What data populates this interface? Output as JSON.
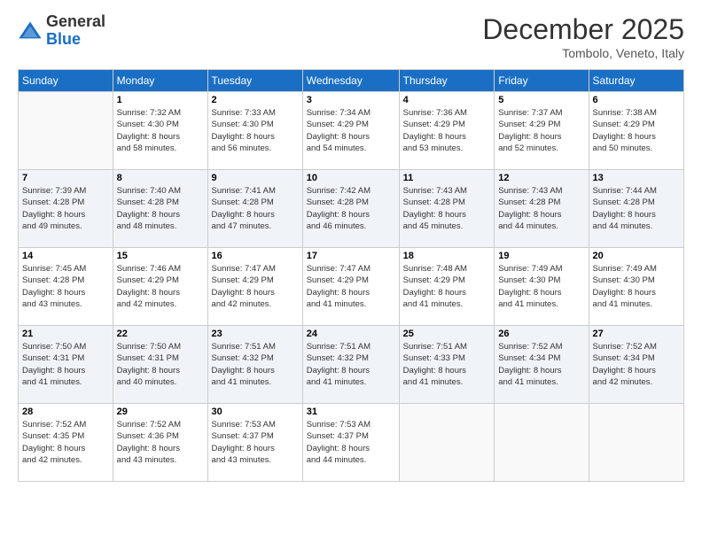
{
  "logo": {
    "general": "General",
    "blue": "Blue"
  },
  "title": "December 2025",
  "location": "Tombolo, Veneto, Italy",
  "weekdays": [
    "Sunday",
    "Monday",
    "Tuesday",
    "Wednesday",
    "Thursday",
    "Friday",
    "Saturday"
  ],
  "weeks": [
    [
      {
        "day": "",
        "info": ""
      },
      {
        "day": "1",
        "info": "Sunrise: 7:32 AM\nSunset: 4:30 PM\nDaylight: 8 hours\nand 58 minutes."
      },
      {
        "day": "2",
        "info": "Sunrise: 7:33 AM\nSunset: 4:30 PM\nDaylight: 8 hours\nand 56 minutes."
      },
      {
        "day": "3",
        "info": "Sunrise: 7:34 AM\nSunset: 4:29 PM\nDaylight: 8 hours\nand 54 minutes."
      },
      {
        "day": "4",
        "info": "Sunrise: 7:36 AM\nSunset: 4:29 PM\nDaylight: 8 hours\nand 53 minutes."
      },
      {
        "day": "5",
        "info": "Sunrise: 7:37 AM\nSunset: 4:29 PM\nDaylight: 8 hours\nand 52 minutes."
      },
      {
        "day": "6",
        "info": "Sunrise: 7:38 AM\nSunset: 4:29 PM\nDaylight: 8 hours\nand 50 minutes."
      }
    ],
    [
      {
        "day": "7",
        "info": "Sunrise: 7:39 AM\nSunset: 4:28 PM\nDaylight: 8 hours\nand 49 minutes."
      },
      {
        "day": "8",
        "info": "Sunrise: 7:40 AM\nSunset: 4:28 PM\nDaylight: 8 hours\nand 48 minutes."
      },
      {
        "day": "9",
        "info": "Sunrise: 7:41 AM\nSunset: 4:28 PM\nDaylight: 8 hours\nand 47 minutes."
      },
      {
        "day": "10",
        "info": "Sunrise: 7:42 AM\nSunset: 4:28 PM\nDaylight: 8 hours\nand 46 minutes."
      },
      {
        "day": "11",
        "info": "Sunrise: 7:43 AM\nSunset: 4:28 PM\nDaylight: 8 hours\nand 45 minutes."
      },
      {
        "day": "12",
        "info": "Sunrise: 7:43 AM\nSunset: 4:28 PM\nDaylight: 8 hours\nand 44 minutes."
      },
      {
        "day": "13",
        "info": "Sunrise: 7:44 AM\nSunset: 4:28 PM\nDaylight: 8 hours\nand 44 minutes."
      }
    ],
    [
      {
        "day": "14",
        "info": "Sunrise: 7:45 AM\nSunset: 4:28 PM\nDaylight: 8 hours\nand 43 minutes."
      },
      {
        "day": "15",
        "info": "Sunrise: 7:46 AM\nSunset: 4:29 PM\nDaylight: 8 hours\nand 42 minutes."
      },
      {
        "day": "16",
        "info": "Sunrise: 7:47 AM\nSunset: 4:29 PM\nDaylight: 8 hours\nand 42 minutes."
      },
      {
        "day": "17",
        "info": "Sunrise: 7:47 AM\nSunset: 4:29 PM\nDaylight: 8 hours\nand 41 minutes."
      },
      {
        "day": "18",
        "info": "Sunrise: 7:48 AM\nSunset: 4:29 PM\nDaylight: 8 hours\nand 41 minutes."
      },
      {
        "day": "19",
        "info": "Sunrise: 7:49 AM\nSunset: 4:30 PM\nDaylight: 8 hours\nand 41 minutes."
      },
      {
        "day": "20",
        "info": "Sunrise: 7:49 AM\nSunset: 4:30 PM\nDaylight: 8 hours\nand 41 minutes."
      }
    ],
    [
      {
        "day": "21",
        "info": "Sunrise: 7:50 AM\nSunset: 4:31 PM\nDaylight: 8 hours\nand 41 minutes."
      },
      {
        "day": "22",
        "info": "Sunrise: 7:50 AM\nSunset: 4:31 PM\nDaylight: 8 hours\nand 40 minutes."
      },
      {
        "day": "23",
        "info": "Sunrise: 7:51 AM\nSunset: 4:32 PM\nDaylight: 8 hours\nand 41 minutes."
      },
      {
        "day": "24",
        "info": "Sunrise: 7:51 AM\nSunset: 4:32 PM\nDaylight: 8 hours\nand 41 minutes."
      },
      {
        "day": "25",
        "info": "Sunrise: 7:51 AM\nSunset: 4:33 PM\nDaylight: 8 hours\nand 41 minutes."
      },
      {
        "day": "26",
        "info": "Sunrise: 7:52 AM\nSunset: 4:34 PM\nDaylight: 8 hours\nand 41 minutes."
      },
      {
        "day": "27",
        "info": "Sunrise: 7:52 AM\nSunset: 4:34 PM\nDaylight: 8 hours\nand 42 minutes."
      }
    ],
    [
      {
        "day": "28",
        "info": "Sunrise: 7:52 AM\nSunset: 4:35 PM\nDaylight: 8 hours\nand 42 minutes."
      },
      {
        "day": "29",
        "info": "Sunrise: 7:52 AM\nSunset: 4:36 PM\nDaylight: 8 hours\nand 43 minutes."
      },
      {
        "day": "30",
        "info": "Sunrise: 7:53 AM\nSunset: 4:37 PM\nDaylight: 8 hours\nand 43 minutes."
      },
      {
        "day": "31",
        "info": "Sunrise: 7:53 AM\nSunset: 4:37 PM\nDaylight: 8 hours\nand 44 minutes."
      },
      {
        "day": "",
        "info": ""
      },
      {
        "day": "",
        "info": ""
      },
      {
        "day": "",
        "info": ""
      }
    ]
  ]
}
